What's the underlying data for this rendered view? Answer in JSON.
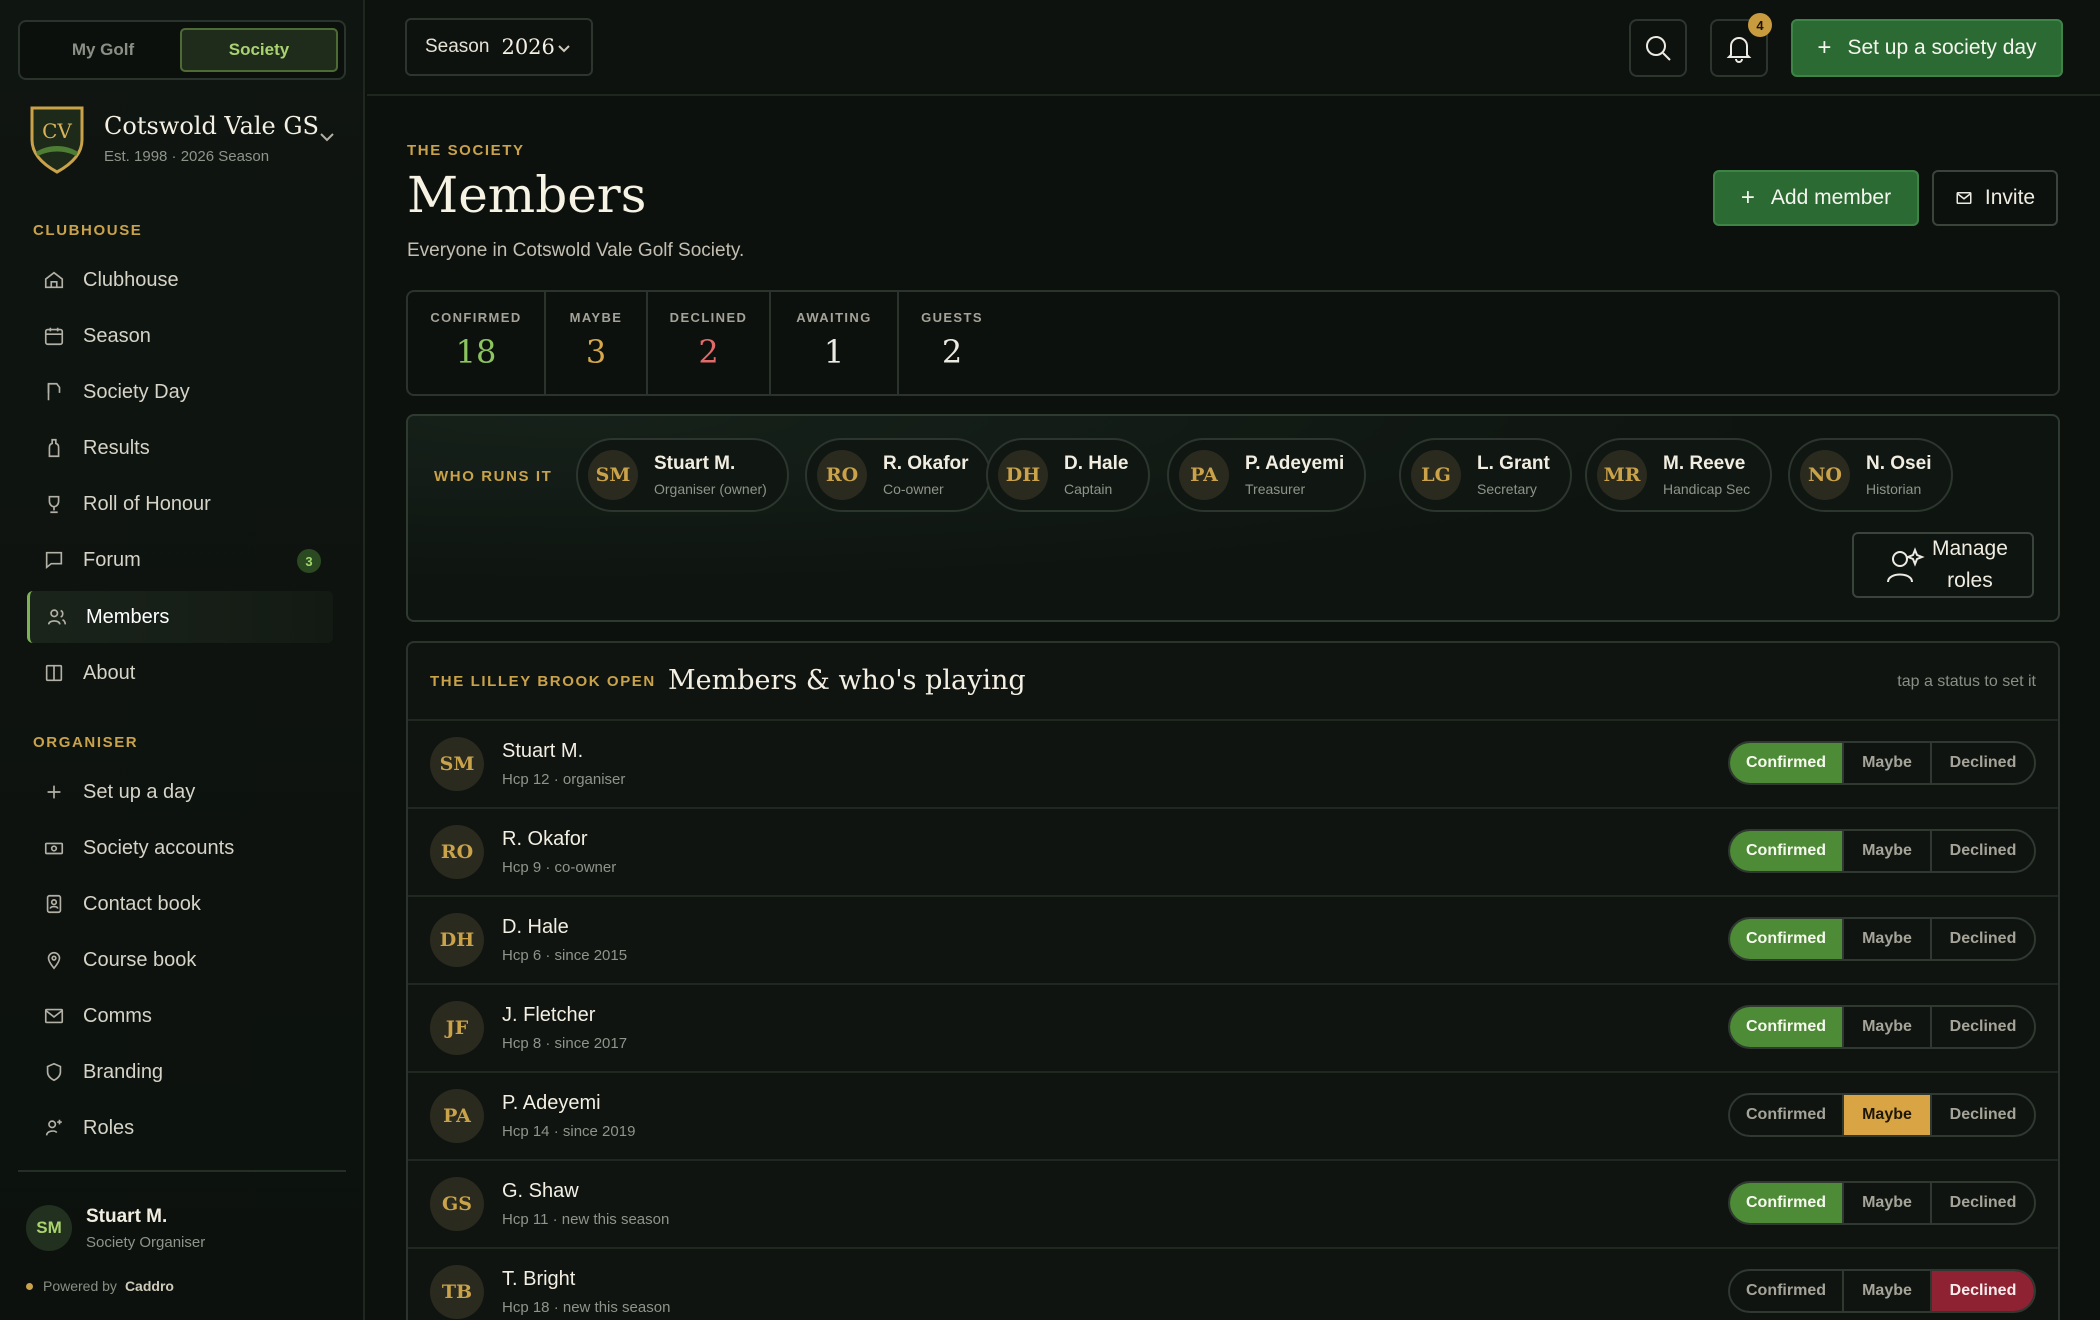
{
  "app": {
    "switcher": [
      "My Golf",
      "Society"
    ],
    "society_name": "Cotswold Vale GS",
    "society_sub": "Est. 1998 · 2026 Season",
    "crest_text": "CV"
  },
  "sidebar": {
    "clubhouse_label": "CLUBHOUSE",
    "organiser_label": "ORGANISER",
    "items": [
      {
        "label": "Clubhouse",
        "icon": "home-icon"
      },
      {
        "label": "Season",
        "icon": "calendar-icon"
      },
      {
        "label": "Society Day",
        "icon": "flag-icon"
      },
      {
        "label": "Results",
        "icon": "bottle-icon"
      },
      {
        "label": "Roll of Honour",
        "icon": "trophy-icon"
      },
      {
        "label": "Forum",
        "icon": "chat-icon",
        "count": "3"
      },
      {
        "label": "Members",
        "icon": "users-icon"
      },
      {
        "label": "About",
        "icon": "book-icon"
      }
    ],
    "organiser_items": [
      {
        "label": "Set up a day",
        "icon": "plus-icon"
      },
      {
        "label": "Society accounts",
        "icon": "money-icon"
      },
      {
        "label": "Contact book",
        "icon": "contact-icon"
      },
      {
        "label": "Course book",
        "icon": "pin-icon"
      },
      {
        "label": "Comms",
        "icon": "mail-icon"
      },
      {
        "label": "Branding",
        "icon": "shield-icon"
      },
      {
        "label": "Roles",
        "icon": "roles-icon"
      }
    ],
    "user": {
      "initials": "SM",
      "name": "Stuart M.",
      "role": "Society Organiser"
    },
    "powered_prefix": "Powered by",
    "powered_brand": "Caddro"
  },
  "topbar": {
    "season_label": "Season",
    "season_year": "2026",
    "notifications": "4",
    "cta": "Set up a society day"
  },
  "page": {
    "eyebrow": "THE SOCIETY",
    "title": "Members",
    "subtitle": "Everyone in Cotswold Vale Golf Society.",
    "add_member": "Add member",
    "invite": "Invite"
  },
  "stats": [
    {
      "label": "CONFIRMED",
      "value": "18",
      "color": "#8cc460"
    },
    {
      "label": "MAYBE",
      "value": "3",
      "color": "#d6a84b"
    },
    {
      "label": "DECLINED",
      "value": "2",
      "color": "#e26a6a"
    },
    {
      "label": "AWAITING",
      "value": "1",
      "color": "#ecebe3"
    },
    {
      "label": "GUESTS",
      "value": "2",
      "color": "#ecebe3"
    }
  ],
  "runs": {
    "label": "WHO RUNS IT",
    "people": [
      {
        "initials": "SM",
        "name": "Stuart M.",
        "role": "Organiser (owner)"
      },
      {
        "initials": "RO",
        "name": "R. Okafor",
        "role": "Co-owner"
      },
      {
        "initials": "DH",
        "name": "D. Hale",
        "role": "Captain"
      },
      {
        "initials": "PA",
        "name": "P. Adeyemi",
        "role": "Treasurer"
      },
      {
        "initials": "LG",
        "name": "L. Grant",
        "role": "Secretary"
      },
      {
        "initials": "MR",
        "name": "M. Reeve",
        "role": "Handicap Sec"
      },
      {
        "initials": "NO",
        "name": "N. Osei",
        "role": "Historian"
      }
    ],
    "manage_line1": "Manage",
    "manage_line2": "roles"
  },
  "players": {
    "event": "THE LILLEY BROOK OPEN",
    "title": "Members & who's playing",
    "hint": "tap a status to set it",
    "options": [
      "Confirmed",
      "Maybe",
      "Declined"
    ],
    "rows": [
      {
        "initials": "SM",
        "name": "Stuart M.",
        "sub": "Hcp 12 · organiser",
        "status": "Confirmed"
      },
      {
        "initials": "RO",
        "name": "R. Okafor",
        "sub": "Hcp 9 · co-owner",
        "status": "Confirmed"
      },
      {
        "initials": "DH",
        "name": "D. Hale",
        "sub": "Hcp 6 · since 2015",
        "status": "Confirmed"
      },
      {
        "initials": "JF",
        "name": "J. Fletcher",
        "sub": "Hcp 8 · since 2017",
        "status": "Confirmed"
      },
      {
        "initials": "PA",
        "name": "P. Adeyemi",
        "sub": "Hcp 14 · since 2019",
        "status": "Maybe"
      },
      {
        "initials": "GS",
        "name": "G. Shaw",
        "sub": "Hcp 11 · new this season",
        "status": "Confirmed"
      },
      {
        "initials": "TB",
        "name": "T. Bright",
        "sub": "Hcp 18 · new this season",
        "status": "Declined"
      }
    ]
  }
}
